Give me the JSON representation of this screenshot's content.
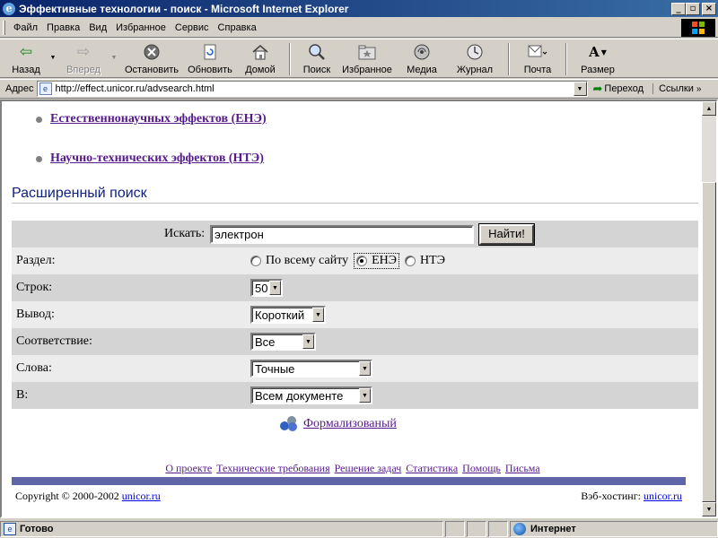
{
  "window": {
    "title": "Эффективные технологии - поиск - Microsoft Internet Explorer",
    "controls": {
      "minimize": "_",
      "maximize": "▫",
      "close": "×"
    }
  },
  "menu": [
    "Файл",
    "Правка",
    "Вид",
    "Избранное",
    "Сервис",
    "Справка"
  ],
  "toolbar": {
    "back": "Назад",
    "forward": "Вперед",
    "stop": "Остановить",
    "refresh": "Обновить",
    "home": "Домой",
    "search": "Поиск",
    "favorites": "Избранное",
    "media": "Медиа",
    "history": "Журнал",
    "mail": "Почта",
    "size": "Размер"
  },
  "address": {
    "label": "Адрес",
    "url": "http://effect.unicor.ru/advsearch.html",
    "go": "Переход",
    "links": "Ссылки"
  },
  "page": {
    "effects": [
      "Естественнонаучных эффектов (ЕНЭ)",
      "Научно-технических эффектов (НТЭ)"
    ],
    "advanced_title": "Расширенный поиск",
    "search": {
      "label": "Искать:",
      "value": "электрон",
      "button": "Найти!"
    },
    "rows": {
      "section_label": "Раздел:",
      "section_options": [
        "По всему сайту",
        "ЕНЭ",
        "НТЭ"
      ],
      "section_selected": "ЕНЭ",
      "rows_label": "Строк:",
      "rows_value": "50",
      "output_label": "Вывод:",
      "output_value": "Короткий",
      "match_label": "Соответствие:",
      "match_value": "Все",
      "words_label": "Слова:",
      "words_value": "Точные",
      "in_label": "В:",
      "in_value": "Всем документе"
    },
    "formal_link": "Формализованый",
    "footer_links": [
      "О проекте",
      "Технические требования",
      "Решение задач",
      "Статистика",
      "Помощь",
      "Письма"
    ],
    "copyright_text": "Copyright © 2000-2002",
    "copyright_link": "unicor.ru",
    "hosting_text": "Вэб-хостинг:",
    "hosting_link": "unicor.ru"
  },
  "status": {
    "text": "Готово",
    "zone": "Интернет"
  },
  "colors": {
    "titlebar_start": "#0a246a",
    "titlebar_end": "#3a6ea5",
    "visited_link": "#551a8b",
    "footer_bar": "#6064a8",
    "heading": "#102080"
  }
}
